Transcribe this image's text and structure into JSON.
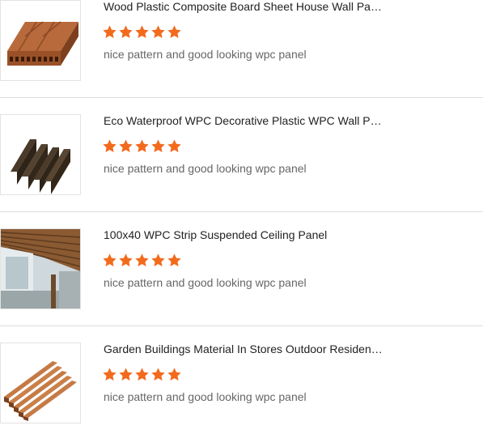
{
  "colors": {
    "star": "#f26b1d",
    "title": "#222222",
    "description": "#666666",
    "divider": "#dddddd"
  },
  "reviews": [
    {
      "title": "Wood Plastic Composite Board Sheet House Wall Pan...",
      "rating": 5,
      "description": "nice pattern and good looking wpc panel",
      "image_icon": "wpc-board-image"
    },
    {
      "title": "Eco Waterproof WPC Decorative Plastic WPC Wall Pa...",
      "rating": 5,
      "description": "nice pattern and good looking wpc panel",
      "image_icon": "wpc-fluted-panel-image"
    },
    {
      "title": "100x40 WPC Strip Suspended Ceiling Panel",
      "rating": 5,
      "description": "nice pattern and good looking wpc panel",
      "image_icon": "ceiling-panel-image"
    },
    {
      "title": "Garden Buildings Material In Stores Outdoor Resident...",
      "rating": 5,
      "description": "nice pattern and good looking wpc panel",
      "image_icon": "wpc-decking-image"
    }
  ]
}
